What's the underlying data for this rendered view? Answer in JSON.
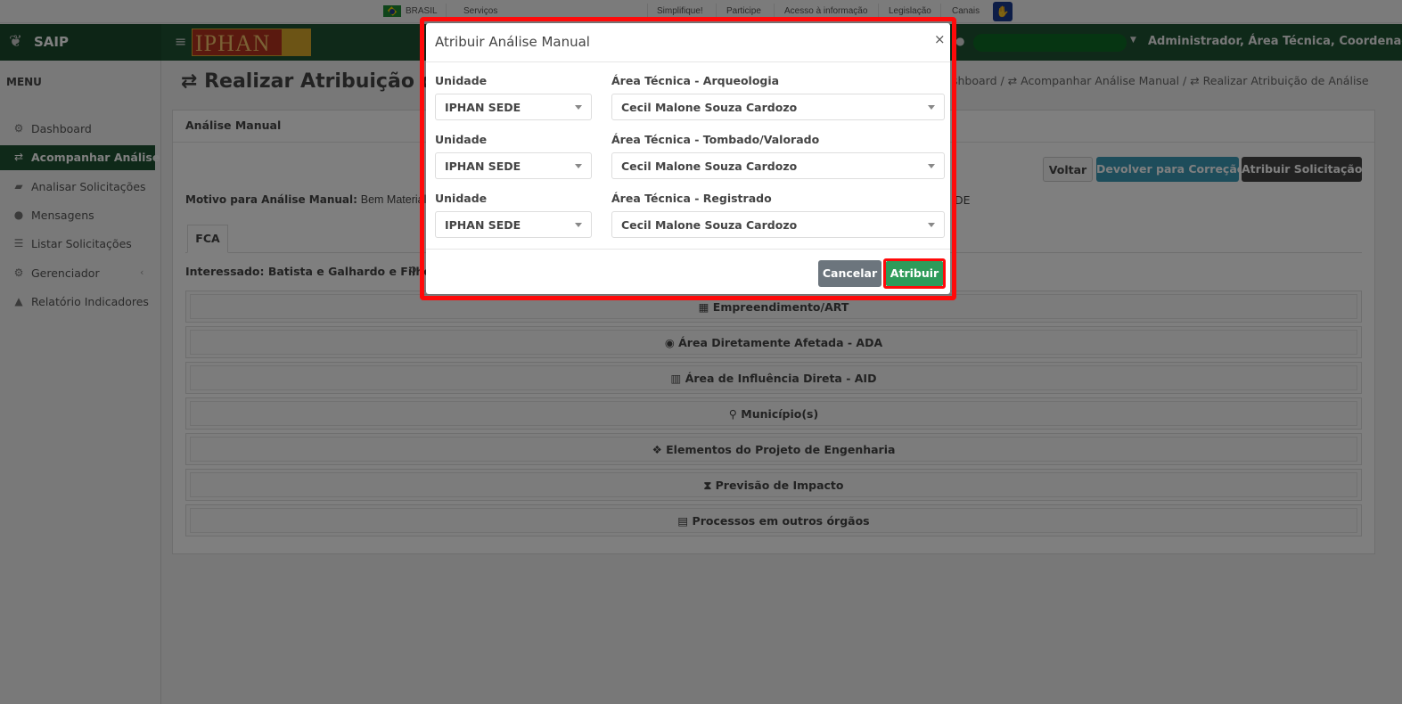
{
  "govbar": {
    "country": "BRASIL",
    "links": [
      "Serviços",
      "Simplifique!",
      "Participe",
      "Acesso à informação",
      "Legislação",
      "Canais"
    ]
  },
  "header": {
    "app_name": "SAIP",
    "logo_text": "IPHAN",
    "roles": "Administrador, Área Técnica, Coordenação..."
  },
  "sidebar": {
    "title": "MENU",
    "items": [
      {
        "label": "Dashboard",
        "icon": "dashboard-icon",
        "glyph": "⚙"
      },
      {
        "label": "Acompanhar Análise",
        "icon": "exchange-icon",
        "glyph": "⇄"
      },
      {
        "label": "Analisar Solicitações",
        "icon": "book-icon",
        "glyph": "▰"
      },
      {
        "label": "Mensagens",
        "icon": "comments-icon",
        "glyph": "●"
      },
      {
        "label": "Listar Solicitações",
        "icon": "list-icon",
        "glyph": "☰"
      },
      {
        "label": "Gerenciador",
        "icon": "cogs-icon",
        "glyph": "⚙"
      },
      {
        "label": "Relatório Indicadores",
        "icon": "area-chart-icon",
        "glyph": "▲"
      }
    ],
    "active_index": 1
  },
  "main": {
    "title": "⇄ Realizar Atribuição de",
    "breadcrumb": "shboard  /  ⇄ Acompanhar Análise Manual  /  ⇄ Realizar Atribuição de Análise",
    "card_title": "Análise Manual",
    "buttons": {
      "voltar": "Voltar",
      "devolver": "Devolver para Correção",
      "atribuir_solicitacao": "Atribuir Solicitação"
    },
    "motivo_label": "Motivo para Análise Manual:",
    "motivo_value": "Bem Material",
    "motivo_tail": "DE",
    "tab": "FCA",
    "interessado": "Interessado: Batista e Galhardo e Filhos",
    "panels": [
      {
        "icon": "building-icon",
        "glyph": "▦",
        "label": "Empreendimento/ART"
      },
      {
        "icon": "globe-icon",
        "glyph": "◉",
        "label": "Área Diretamente Afetada - ADA"
      },
      {
        "icon": "map-icon",
        "glyph": "▥",
        "label": "Área de Influência Direta - AID"
      },
      {
        "icon": "map-marker-icon",
        "glyph": "⚲",
        "label": "Município(s)"
      },
      {
        "icon": "cubes-icon",
        "glyph": "❖",
        "label": "Elementos do Projeto de Engenharia"
      },
      {
        "icon": "hourglass-icon",
        "glyph": "⧗",
        "label": "Previsão de Impacto"
      },
      {
        "icon": "archive-icon",
        "glyph": "▤",
        "label": "Processos em outros órgãos"
      }
    ]
  },
  "modal": {
    "title": "Atribuir Análise Manual",
    "close": "×",
    "rows": [
      {
        "unit_label": "Unidade",
        "unit_value": "IPHAN SEDE",
        "area_label": "Área Técnica - Arqueologia",
        "area_value": "Cecil Malone Souza Cardozo"
      },
      {
        "unit_label": "Unidade",
        "unit_value": "IPHAN SEDE",
        "area_label": "Área Técnica - Tombado/Valorado",
        "area_value": "Cecil Malone Souza Cardozo"
      },
      {
        "unit_label": "Unidade",
        "unit_value": "IPHAN SEDE",
        "area_label": "Área Técnica - Registrado",
        "area_value": "Cecil Malone Souza Cardozo"
      }
    ],
    "cancel_label": "Cancelar",
    "submit_label": "Atribuir"
  },
  "colors": {
    "header_green": "#1f5233",
    "highlight_red": "#ff0a0a",
    "submit_green": "#2e9b5a",
    "info_blue": "#3c9bb7"
  }
}
